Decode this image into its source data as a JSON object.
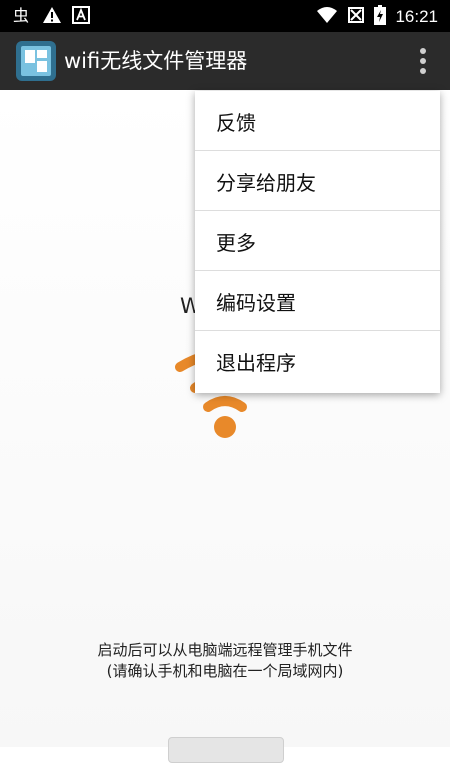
{
  "status_bar": {
    "time": "16:21",
    "left_icons": [
      "bug-icon",
      "warning-icon",
      "a-icon"
    ],
    "right_icons": [
      "wifi-icon",
      "no-sim-icon",
      "battery-icon"
    ]
  },
  "app_bar": {
    "title": "wifi无线文件管理器"
  },
  "menu": {
    "items": [
      {
        "label": "反馈"
      },
      {
        "label": "分享给朋友"
      },
      {
        "label": "更多"
      },
      {
        "label": "编码设置"
      },
      {
        "label": "退出程序"
      }
    ]
  },
  "main": {
    "ssid_label": "W",
    "hint_line1": "启动后可以从电脑端远程管理手机文件",
    "hint_line2": "(请确认手机和电脑在一个局域网内)",
    "wifi_color": "#e8892a"
  },
  "colors": {
    "status_bar": "#000000",
    "app_bar": "#2b2b2b",
    "accent": "#e8892a"
  }
}
